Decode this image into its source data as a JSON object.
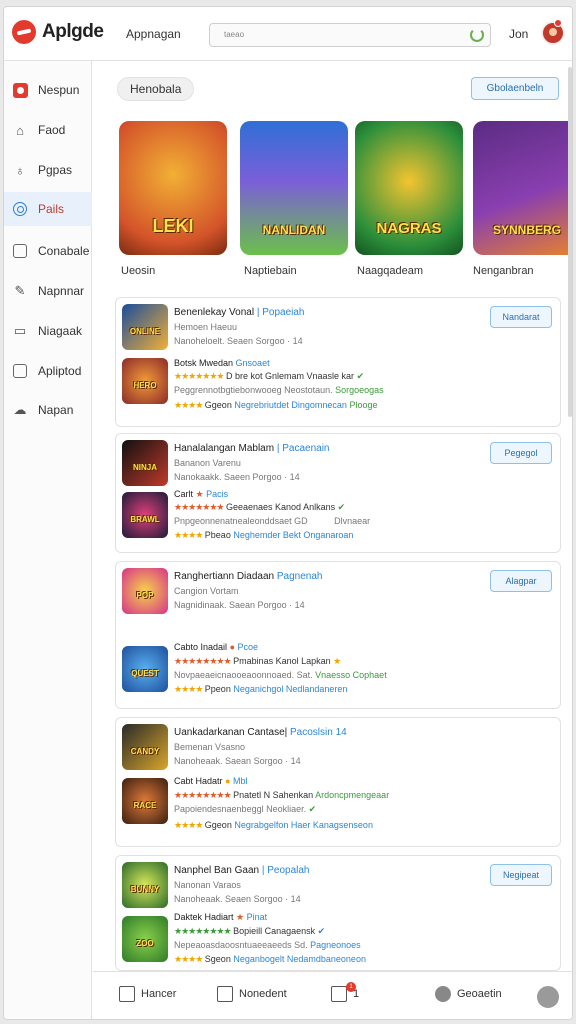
{
  "header": {
    "brand": "Aplgde",
    "nav_label": "Appnagan",
    "search_placeholder": "taeao",
    "user_name": "Jon"
  },
  "sidebar": {
    "items": [
      {
        "label": "Nespun",
        "icon": "app-icon",
        "active": false
      },
      {
        "label": "Faod",
        "icon": "home-icon",
        "active": false
      },
      {
        "label": "Pgpas",
        "icon": "lightbulb-icon",
        "active": false
      },
      {
        "label": "Pails",
        "icon": "target-icon",
        "active": true
      },
      {
        "label": "Conabale",
        "icon": "tablet-icon",
        "active": false
      },
      {
        "label": "Napnnar",
        "icon": "pen-icon",
        "active": false
      },
      {
        "label": "Niagaak",
        "icon": "folder-icon",
        "active": false
      },
      {
        "label": "Apliptod",
        "icon": "document-icon",
        "active": false
      },
      {
        "label": "Napan",
        "icon": "cloud-icon",
        "active": false
      }
    ]
  },
  "main": {
    "section_pill": "Henobala",
    "top_button": "Gbolaenbeln",
    "banners": [
      {
        "label": "Ueosin",
        "art_text": "LEKI",
        "colors": [
          "#d4542a",
          "#f2b035"
        ]
      },
      {
        "label": "Naptiebain",
        "art_text": "NANLIDAN",
        "colors": [
          "#2f6fd6",
          "#6bc04a"
        ]
      },
      {
        "label": "Naagqadeam",
        "art_text": "NAGRAS",
        "colors": [
          "#2c8f3b",
          "#f4c430"
        ]
      },
      {
        "label": "Nenganbran",
        "art_text": "SYNNBERG",
        "colors": [
          "#5b2c83",
          "#e8832a"
        ]
      }
    ],
    "cards": [
      {
        "button": "Nandarat",
        "title": "Benenlekay Vonal",
        "title_tag": "| Popaeiah",
        "sub1": "Hemoen Haeuu",
        "sub2": "Nanoheloelt. Seaen Sorgoo · 14",
        "thumbs_art": [
          "ONLINE",
          "HERO"
        ],
        "row1_name": "Botsk Mwedan",
        "row1_tag": "Gnsoaet",
        "row1_stars": "★★★★★★★",
        "row1_text": "D bre kot Gnlemam Vnaasle kar",
        "row2_text": "Peggrennotbgtiebonwooeg Neostotaun.",
        "row2_green": "Sorgoeogas",
        "row3_stars": "★★★★",
        "row3_text": "Ggeon",
        "row3_blue": "Negrebriutdet Dingomnecan",
        "row3_green": "Plooge"
      },
      {
        "button": "Pegegol",
        "title": "Hanalalangan Mablam",
        "title_tag": "| Pacaenain",
        "sub1": "Bananon Varenu",
        "sub2": "Nanokaakk. Saeen Porgoo · 14",
        "thumbs_art": [
          "NINJA",
          "BRAWL"
        ],
        "row1_name": "Carlt",
        "row1_tag": "Pacis",
        "row1_stars": "★★★★★★★",
        "row1_text": "Geeaenaes Kanod Anlkans",
        "row2_text": "Pnpgeonnenatnealeonddsaet GD",
        "row2_green": "Dlvnaear",
        "row3_stars": "★★★★",
        "row3_text": "Pbeao",
        "row3_blue": "Neghemder Bekt Onganaroan",
        "row3_green": ""
      },
      {
        "button": "Alagpar",
        "title": "Ranghertiann Diadaan",
        "title_tag": "Pagnenah",
        "sub1": "Cangion Vortam",
        "sub2": "Nagnidinaak. Saean Porgoo · 14",
        "thumbs_art": [
          "POP",
          "QUEST"
        ],
        "row1_name": "Cabto Inadail",
        "row1_tag": "Pcoe",
        "row1_stars": "★★★★★★★★",
        "row1_text": "Pmabinas Kanol Lapkan",
        "row2_text": "Novpaeaeicnaooeaoonnoaed. Sat.",
        "row2_green": "Vnaesso Cophaet",
        "row3_stars": "★★★★",
        "row3_text": "Ppeon",
        "row3_blue": "Neganichgol Nedlandaneren",
        "row3_green": ""
      },
      {
        "button": "",
        "title": "Uankadarkanan Cantase|",
        "title_tag": "Pacoslsin 14",
        "sub1": "Bemenan Vsasno",
        "sub2": "Nanoheaak. Saean Sorgoo · 14",
        "thumbs_art": [
          "CANDY",
          "RACE"
        ],
        "row1_name": "Cabt Hadatr",
        "row1_tag": "Mbl",
        "row1_stars": "★★★★★★★★",
        "row1_text": "Pnatetl N Sahenkan",
        "row2_text": "Papoiendesnaenbeggl Neokliaer.",
        "row2_green": "Ardoncpmengeaar",
        "row3_stars": "★★★★",
        "row3_text": "Ggeon",
        "row3_blue": "Negrabgelfon Haer Kanagsenseon",
        "row3_green": ""
      },
      {
        "button": "Negipeat",
        "title": "Nanphel Ban Gaan",
        "title_tag": "| Peopalah",
        "sub1": "Nanonan Varaos",
        "sub2": "Nanoheaak. Seaen Sorgoo · 14",
        "thumbs_art": [
          "BUNNY",
          "ZOO"
        ],
        "row1_name": "Daktek Hadiart",
        "row1_tag": "Pinat",
        "row1_stars": "★★★★★★★★",
        "row1_text": "Bopieill Canagaensk",
        "row2_text": "Nepeaoasdaoosntuaeeaeeds Sd.",
        "row2_green": "Pagneonoes",
        "row3_stars": "★★★★",
        "row3_text": "Sgeon",
        "row3_blue": "Neganbogelt Nedamdbaneoneon",
        "row3_green": ""
      }
    ]
  },
  "bottom_bar": {
    "items": [
      {
        "label": "Hancer",
        "icon": "grid-icon"
      },
      {
        "label": "Nonedent",
        "icon": "edit-icon"
      },
      {
        "label": "1",
        "icon": "table-icon",
        "badge": "1"
      },
      {
        "label": "Geoaetin",
        "icon": "user-icon"
      }
    ]
  },
  "colors": {
    "accent": "#2a86d8",
    "brand_red": "#e23b2e",
    "star": "#f0a500"
  }
}
